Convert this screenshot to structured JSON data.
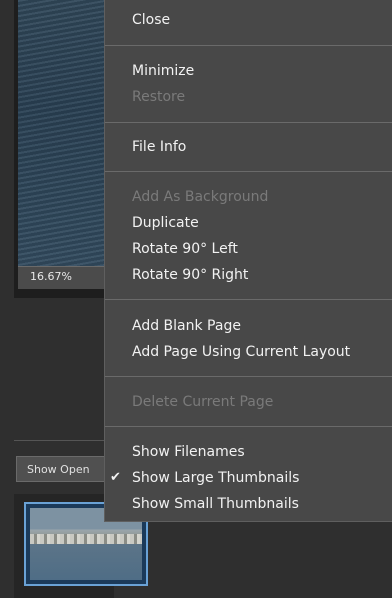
{
  "document": {
    "zoom_label": "16.67%",
    "show_select_label": "Show Open"
  },
  "menu": {
    "close": "Close",
    "minimize": "Minimize",
    "restore": "Restore",
    "file_info": "File Info",
    "add_as_background": "Add As Background",
    "duplicate": "Duplicate",
    "rotate_left": "Rotate 90° Left",
    "rotate_right": "Rotate 90° Right",
    "add_blank_page": "Add Blank Page",
    "add_page_current_layout": "Add Page Using Current Layout",
    "delete_current_page": "Delete Current Page",
    "show_filenames": "Show Filenames",
    "show_large_thumbnails": "Show Large Thumbnails",
    "show_small_thumbnails": "Show Small Thumbnails",
    "check_glyph": "✔"
  },
  "colors": {
    "menu_bg": "#484848",
    "text": "#f2f2f2",
    "disabled_text": "#7a7a7a",
    "thumb_border": "#6aa2d6"
  }
}
